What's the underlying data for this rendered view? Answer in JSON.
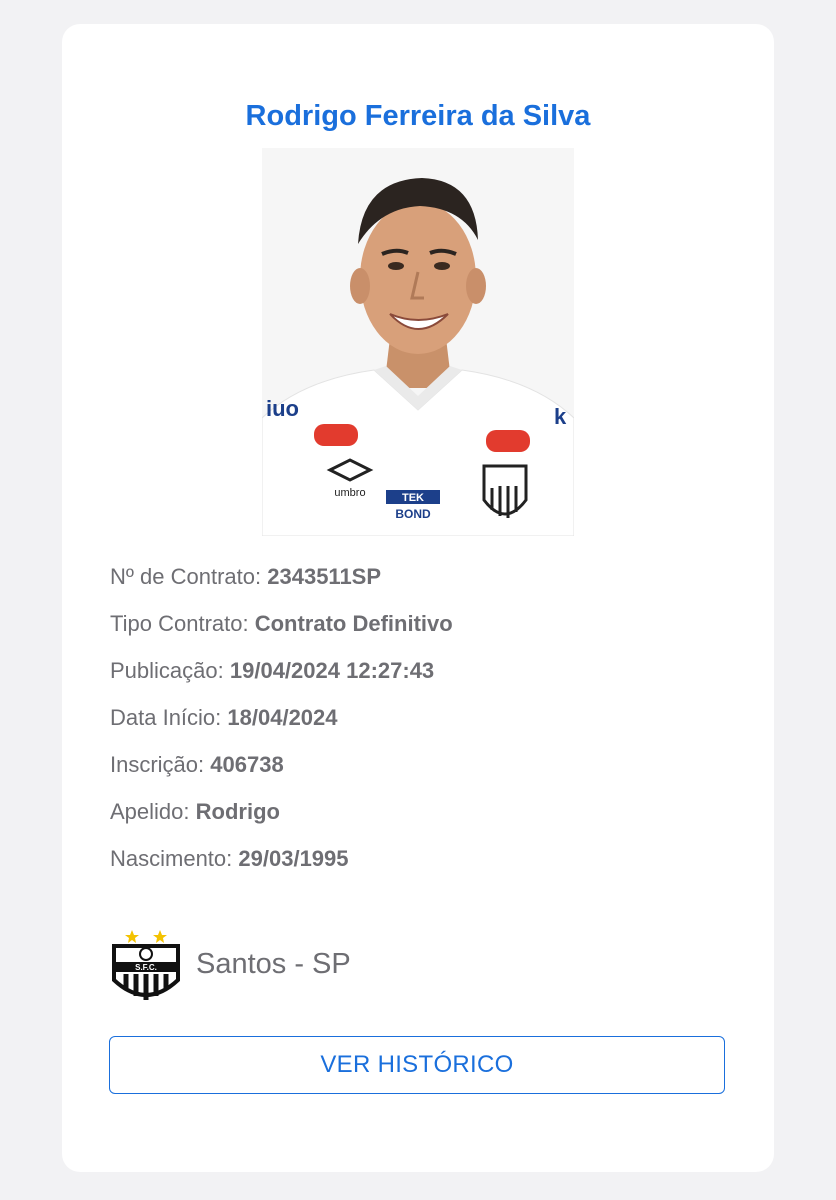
{
  "player": {
    "name": "Rodrigo Ferreira da Silva",
    "photo_alt": "player-photo"
  },
  "details": [
    {
      "label": "Nº de Contrato:",
      "value": "2343511SP"
    },
    {
      "label": "Tipo Contrato:",
      "value": "Contrato Definitivo"
    },
    {
      "label": "Publicação:",
      "value": "19/04/2024 12:27:43"
    },
    {
      "label": "Data Início:",
      "value": "18/04/2024"
    },
    {
      "label": "Inscrição:",
      "value": "406738"
    },
    {
      "label": "Apelido:",
      "value": "Rodrigo"
    },
    {
      "label": "Nascimento:",
      "value": "29/03/1995"
    }
  ],
  "club": {
    "name": "Santos - SP",
    "logo_icon": "santos-crest-icon"
  },
  "actions": {
    "history_button": "VER HISTÓRICO"
  },
  "colors": {
    "accent": "#1a6fdc",
    "text_muted": "#6e6e73",
    "background": "#f2f2f4",
    "card": "#ffffff"
  }
}
